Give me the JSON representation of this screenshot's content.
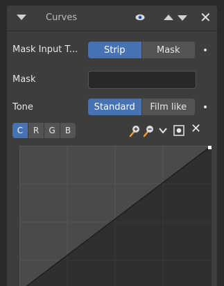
{
  "header": {
    "title": "Curves"
  },
  "rows": {
    "mask_input": {
      "label": "Mask Input T...",
      "options": [
        "Strip",
        "Mask"
      ],
      "selected": "Strip"
    },
    "mask": {
      "label": "Mask",
      "value": ""
    },
    "tone": {
      "label": "Tone",
      "options": [
        "Standard",
        "Film like"
      ],
      "selected": "Standard"
    }
  },
  "channels": {
    "items": [
      "C",
      "R",
      "G",
      "B"
    ],
    "selected": "C"
  },
  "curve_tools": {
    "icons": [
      "zoom-in-icon",
      "zoom-out-icon",
      "chevron-down-icon",
      "clipping-icon",
      "close-icon"
    ]
  },
  "colors": {
    "accent": "#4772b3",
    "panel_bg": "#3d3d3d",
    "graph_bg_upper": "#4a4a4a",
    "graph_bg_lower": "#2f2f2f"
  }
}
